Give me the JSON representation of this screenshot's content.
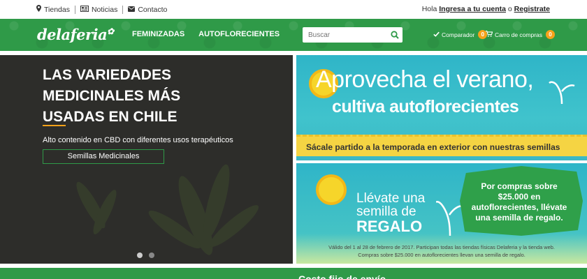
{
  "topbar": {
    "links": [
      {
        "label": "Tiendas",
        "icon": "map-marker-icon"
      },
      {
        "label": "Noticias",
        "icon": "newspaper-icon"
      },
      {
        "label": "Contacto",
        "icon": "envelope-icon"
      }
    ],
    "greeting": "Hola",
    "login": "Ingresa a tu cuenta",
    "or": "o",
    "register": "Registrate"
  },
  "header": {
    "logo": "delaferia",
    "nav": [
      "FEMINIZADAS",
      "AUTOFLORECIENTES"
    ],
    "search_placeholder": "Buscar",
    "comparator": {
      "label": "Comparador",
      "count": "0"
    },
    "cart": {
      "label": "Carro de compras",
      "count": "0"
    },
    "brand_green": "#2f9a48",
    "accent_orange": "#f7a21a"
  },
  "hero": {
    "title": "LAS VARIEDADES MEDICINALES MÁS USADAS EN CHILE",
    "subtitle": "Alto contenido en CBD con diferentes usos terapéuticos",
    "cta": "Semillas Medicinales",
    "slides": 2,
    "active_slide": 1
  },
  "banner1": {
    "line1": "Aprovecha el verano,",
    "line2": "cultiva autoflorecientes",
    "bar": "Sácale partido a la temporada en exterior con nuestras semillas"
  },
  "banner2": {
    "line1": "Llévate una",
    "line1b": "semilla de",
    "line2": "REGALO",
    "promo": "Por compras sobre $25.000 en autoflorecientes, llévate una semilla de regalo.",
    "fine1": "Válido del 1 al 28 de febrero de 2017. Participan todas las tiendas físicas Delaferia y la tienda web.",
    "fine2": "Compras sobre $25.000 en autoflorecientes llevan una semilla de regalo."
  },
  "bottom": {
    "text": "Costo fijo de envío"
  }
}
